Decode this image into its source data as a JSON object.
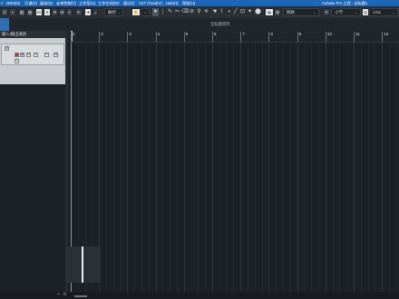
{
  "menubar": {
    "items": [
      "MIDI(M)",
      "乐谱(S)",
      "媒体(D)",
      "走带控制(T)",
      "工作室(U)",
      "工作空间(W)",
      "窗口(I)",
      "VST Cloud(V)",
      "Hub(H)",
      "帮助(H)"
    ],
    "app_title": "Cubase Pro 工程 - 无标题1",
    "accent_color": "#1a66b8"
  },
  "toolbar": {
    "touch_mode_label": "触控",
    "grid_type_label": "网格",
    "quantize_label": "小节",
    "quantize_value": "1/16",
    "transport_buttons": [
      "R",
      "W",
      "A"
    ],
    "tools": [
      "pointer-icon",
      "range-icon",
      "pencil-icon",
      "eraser-icon",
      "scissors-icon",
      "glue-icon",
      "mute-icon",
      "zoom-icon",
      "hand-icon",
      "line-icon",
      "speaker-icon",
      "color-icon"
    ]
  },
  "project": {
    "window_label": "无标题项目"
  },
  "tracks": {
    "header_label": "输入/输出通道",
    "track_name": " "
  },
  "ruler": {
    "bars": [
      "1",
      "2",
      "3",
      "4",
      "5",
      "6",
      "7",
      "8",
      "9",
      "10",
      "11",
      "12"
    ]
  }
}
